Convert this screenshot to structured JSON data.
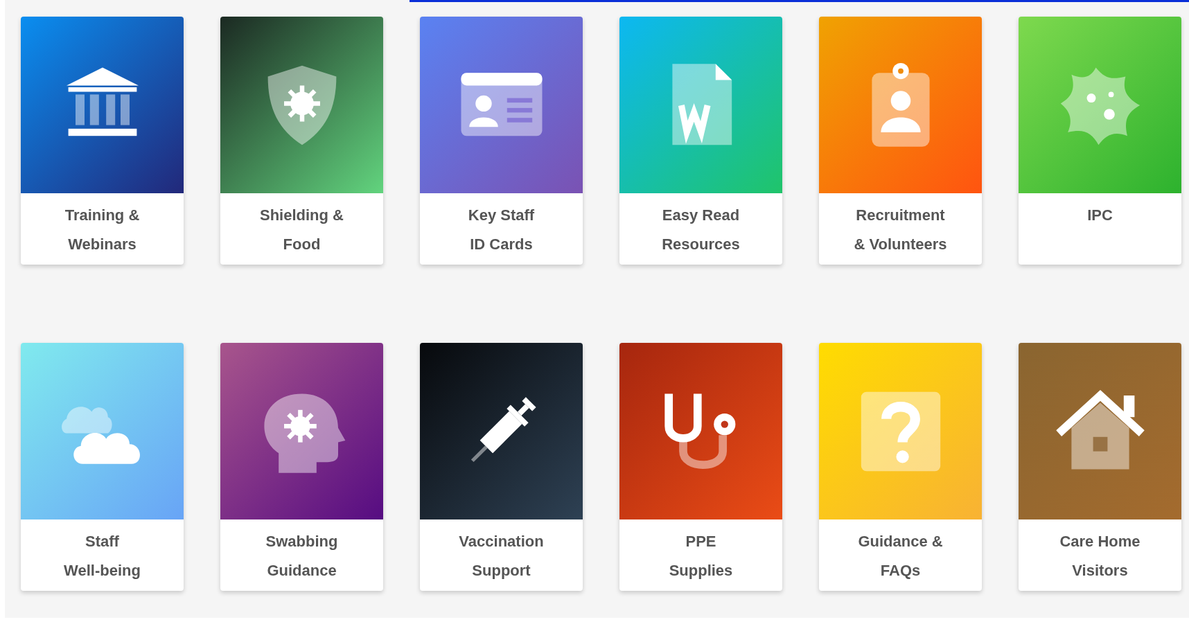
{
  "tiles": [
    {
      "kind": "bank",
      "lines": [
        "Training &",
        "Webinars"
      ],
      "color": "#0a8ef0"
    },
    {
      "kind": "shield",
      "lines": [
        "Shielding &",
        "Food"
      ],
      "color": "#1b2922"
    },
    {
      "kind": "idcard",
      "lines": [
        "Key Staff",
        "ID Cards"
      ],
      "color": "#5a82f2"
    },
    {
      "kind": "document",
      "lines": [
        "Easy Read",
        "Resources"
      ],
      "color": "#0cb8f2"
    },
    {
      "kind": "badge",
      "lines": [
        "Recruitment",
        "& Volunteers"
      ],
      "color": "#f0a202"
    },
    {
      "kind": "germ",
      "lines": [
        "IPC"
      ],
      "color": "#7ed94e"
    },
    {
      "kind": "cloud",
      "lines": [
        "Staff",
        "Well-being"
      ],
      "color": "#80eaee"
    },
    {
      "kind": "head",
      "lines": [
        "Swabbing",
        "Guidance"
      ],
      "color": "#a8558c"
    },
    {
      "kind": "syringe",
      "lines": [
        "Vaccination",
        "Support"
      ],
      "color": "#07090c"
    },
    {
      "kind": "stethoscope",
      "lines": [
        "PPE",
        "Supplies"
      ],
      "color": "#a6260e"
    },
    {
      "kind": "question",
      "lines": [
        "Guidance &",
        "FAQs"
      ],
      "color": "#ffdc00"
    },
    {
      "kind": "house",
      "lines": [
        "Care Home",
        "Visitors"
      ],
      "color": "#8a6530"
    }
  ]
}
